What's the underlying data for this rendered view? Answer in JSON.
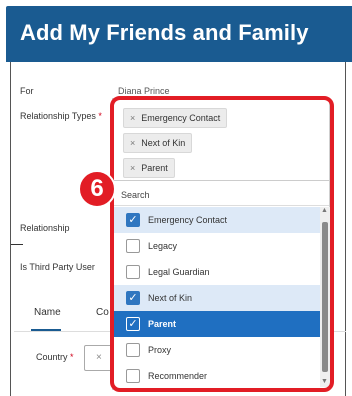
{
  "header": {
    "title": "Add My Friends and Family"
  },
  "form": {
    "for_label": "For",
    "for_value": "Diana Prince",
    "relationship_types_label": "Relationship Types",
    "required_mark": "*",
    "relationship_label": "Relationship",
    "third_party_label": "Is Third Party User",
    "country_label": "Country",
    "country_clear": "×"
  },
  "tabs": {
    "name": "Name",
    "contact": "Co"
  },
  "dropdown": {
    "chips": [
      {
        "label": "Emergency Contact",
        "remove": "×"
      },
      {
        "label": "Next of Kin",
        "remove": "×"
      },
      {
        "label": "Parent",
        "remove": "×"
      }
    ],
    "search_label": "Search",
    "options": [
      {
        "label": "Emergency Contact",
        "checked": true
      },
      {
        "label": "Legacy",
        "checked": false
      },
      {
        "label": "Legal Guardian",
        "checked": false
      },
      {
        "label": "Next of Kin",
        "checked": true
      },
      {
        "label": "Parent",
        "checked": true,
        "active": true
      },
      {
        "label": "Proxy",
        "checked": false
      },
      {
        "label": "Recommender",
        "checked": false
      }
    ],
    "check_glyph": "✓",
    "list_icon_glyph": "☰"
  },
  "annotation": {
    "step_number": "6"
  },
  "colors": {
    "header_bg": "#1a5b91",
    "highlight": "#e21d25",
    "active_option": "#1f6fc1",
    "selected_option": "#dde9f7",
    "checkbox_on": "#2f76c0"
  }
}
